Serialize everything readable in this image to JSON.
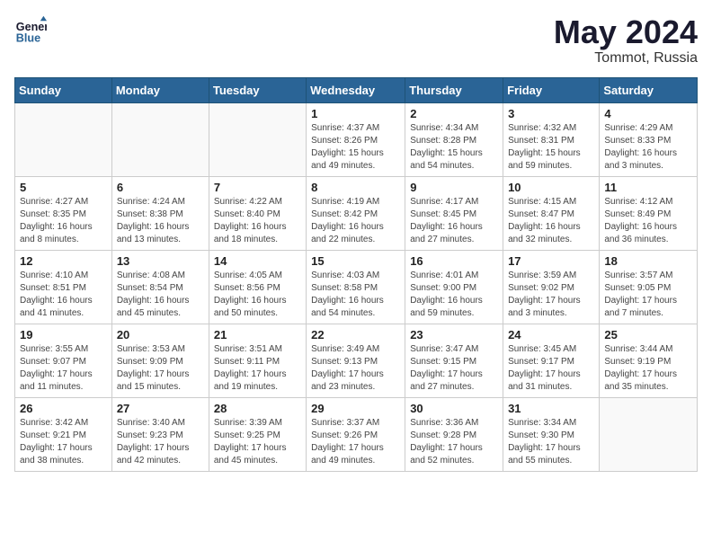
{
  "logo": {
    "line1": "General",
    "line2": "Blue"
  },
  "title": "May 2024",
  "location": "Tommot, Russia",
  "weekdays": [
    "Sunday",
    "Monday",
    "Tuesday",
    "Wednesday",
    "Thursday",
    "Friday",
    "Saturday"
  ],
  "weeks": [
    [
      {
        "day": "",
        "sunrise": "",
        "sunset": "",
        "daylight": ""
      },
      {
        "day": "",
        "sunrise": "",
        "sunset": "",
        "daylight": ""
      },
      {
        "day": "",
        "sunrise": "",
        "sunset": "",
        "daylight": ""
      },
      {
        "day": "1",
        "sunrise": "Sunrise: 4:37 AM",
        "sunset": "Sunset: 8:26 PM",
        "daylight": "Daylight: 15 hours and 49 minutes."
      },
      {
        "day": "2",
        "sunrise": "Sunrise: 4:34 AM",
        "sunset": "Sunset: 8:28 PM",
        "daylight": "Daylight: 15 hours and 54 minutes."
      },
      {
        "day": "3",
        "sunrise": "Sunrise: 4:32 AM",
        "sunset": "Sunset: 8:31 PM",
        "daylight": "Daylight: 15 hours and 59 minutes."
      },
      {
        "day": "4",
        "sunrise": "Sunrise: 4:29 AM",
        "sunset": "Sunset: 8:33 PM",
        "daylight": "Daylight: 16 hours and 3 minutes."
      }
    ],
    [
      {
        "day": "5",
        "sunrise": "Sunrise: 4:27 AM",
        "sunset": "Sunset: 8:35 PM",
        "daylight": "Daylight: 16 hours and 8 minutes."
      },
      {
        "day": "6",
        "sunrise": "Sunrise: 4:24 AM",
        "sunset": "Sunset: 8:38 PM",
        "daylight": "Daylight: 16 hours and 13 minutes."
      },
      {
        "day": "7",
        "sunrise": "Sunrise: 4:22 AM",
        "sunset": "Sunset: 8:40 PM",
        "daylight": "Daylight: 16 hours and 18 minutes."
      },
      {
        "day": "8",
        "sunrise": "Sunrise: 4:19 AM",
        "sunset": "Sunset: 8:42 PM",
        "daylight": "Daylight: 16 hours and 22 minutes."
      },
      {
        "day": "9",
        "sunrise": "Sunrise: 4:17 AM",
        "sunset": "Sunset: 8:45 PM",
        "daylight": "Daylight: 16 hours and 27 minutes."
      },
      {
        "day": "10",
        "sunrise": "Sunrise: 4:15 AM",
        "sunset": "Sunset: 8:47 PM",
        "daylight": "Daylight: 16 hours and 32 minutes."
      },
      {
        "day": "11",
        "sunrise": "Sunrise: 4:12 AM",
        "sunset": "Sunset: 8:49 PM",
        "daylight": "Daylight: 16 hours and 36 minutes."
      }
    ],
    [
      {
        "day": "12",
        "sunrise": "Sunrise: 4:10 AM",
        "sunset": "Sunset: 8:51 PM",
        "daylight": "Daylight: 16 hours and 41 minutes."
      },
      {
        "day": "13",
        "sunrise": "Sunrise: 4:08 AM",
        "sunset": "Sunset: 8:54 PM",
        "daylight": "Daylight: 16 hours and 45 minutes."
      },
      {
        "day": "14",
        "sunrise": "Sunrise: 4:05 AM",
        "sunset": "Sunset: 8:56 PM",
        "daylight": "Daylight: 16 hours and 50 minutes."
      },
      {
        "day": "15",
        "sunrise": "Sunrise: 4:03 AM",
        "sunset": "Sunset: 8:58 PM",
        "daylight": "Daylight: 16 hours and 54 minutes."
      },
      {
        "day": "16",
        "sunrise": "Sunrise: 4:01 AM",
        "sunset": "Sunset: 9:00 PM",
        "daylight": "Daylight: 16 hours and 59 minutes."
      },
      {
        "day": "17",
        "sunrise": "Sunrise: 3:59 AM",
        "sunset": "Sunset: 9:02 PM",
        "daylight": "Daylight: 17 hours and 3 minutes."
      },
      {
        "day": "18",
        "sunrise": "Sunrise: 3:57 AM",
        "sunset": "Sunset: 9:05 PM",
        "daylight": "Daylight: 17 hours and 7 minutes."
      }
    ],
    [
      {
        "day": "19",
        "sunrise": "Sunrise: 3:55 AM",
        "sunset": "Sunset: 9:07 PM",
        "daylight": "Daylight: 17 hours and 11 minutes."
      },
      {
        "day": "20",
        "sunrise": "Sunrise: 3:53 AM",
        "sunset": "Sunset: 9:09 PM",
        "daylight": "Daylight: 17 hours and 15 minutes."
      },
      {
        "day": "21",
        "sunrise": "Sunrise: 3:51 AM",
        "sunset": "Sunset: 9:11 PM",
        "daylight": "Daylight: 17 hours and 19 minutes."
      },
      {
        "day": "22",
        "sunrise": "Sunrise: 3:49 AM",
        "sunset": "Sunset: 9:13 PM",
        "daylight": "Daylight: 17 hours and 23 minutes."
      },
      {
        "day": "23",
        "sunrise": "Sunrise: 3:47 AM",
        "sunset": "Sunset: 9:15 PM",
        "daylight": "Daylight: 17 hours and 27 minutes."
      },
      {
        "day": "24",
        "sunrise": "Sunrise: 3:45 AM",
        "sunset": "Sunset: 9:17 PM",
        "daylight": "Daylight: 17 hours and 31 minutes."
      },
      {
        "day": "25",
        "sunrise": "Sunrise: 3:44 AM",
        "sunset": "Sunset: 9:19 PM",
        "daylight": "Daylight: 17 hours and 35 minutes."
      }
    ],
    [
      {
        "day": "26",
        "sunrise": "Sunrise: 3:42 AM",
        "sunset": "Sunset: 9:21 PM",
        "daylight": "Daylight: 17 hours and 38 minutes."
      },
      {
        "day": "27",
        "sunrise": "Sunrise: 3:40 AM",
        "sunset": "Sunset: 9:23 PM",
        "daylight": "Daylight: 17 hours and 42 minutes."
      },
      {
        "day": "28",
        "sunrise": "Sunrise: 3:39 AM",
        "sunset": "Sunset: 9:25 PM",
        "daylight": "Daylight: 17 hours and 45 minutes."
      },
      {
        "day": "29",
        "sunrise": "Sunrise: 3:37 AM",
        "sunset": "Sunset: 9:26 PM",
        "daylight": "Daylight: 17 hours and 49 minutes."
      },
      {
        "day": "30",
        "sunrise": "Sunrise: 3:36 AM",
        "sunset": "Sunset: 9:28 PM",
        "daylight": "Daylight: 17 hours and 52 minutes."
      },
      {
        "day": "31",
        "sunrise": "Sunrise: 3:34 AM",
        "sunset": "Sunset: 9:30 PM",
        "daylight": "Daylight: 17 hours and 55 minutes."
      },
      {
        "day": "",
        "sunrise": "",
        "sunset": "",
        "daylight": ""
      }
    ]
  ]
}
